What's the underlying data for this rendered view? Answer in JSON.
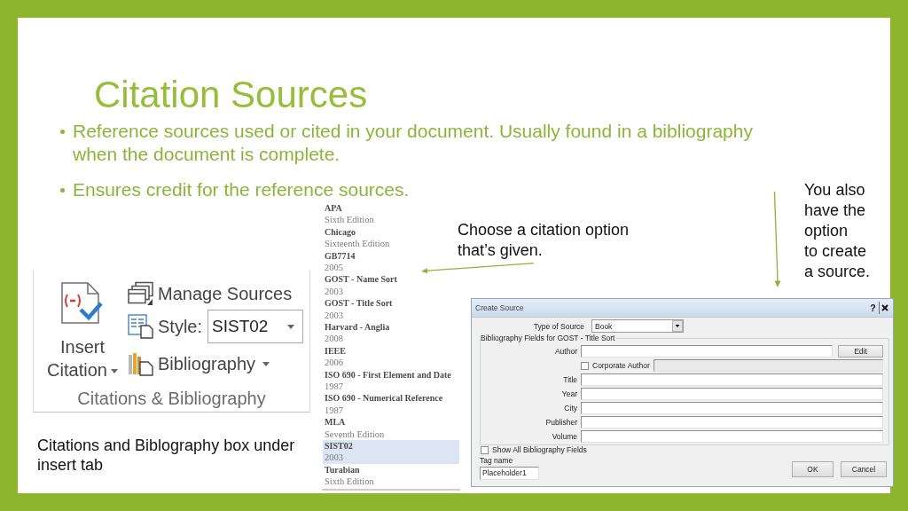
{
  "slide": {
    "title": "Citation Sources",
    "bullets": [
      "Reference sources used or cited in your document. Usually found in a bibliography when the document is complete.",
      "Ensures credit for the reference sources."
    ]
  },
  "style_list": {
    "items": [
      {
        "name": "APA",
        "edition": "Sixth Edition",
        "selected": false
      },
      {
        "name": "Chicago",
        "edition": "Sixteenth Edition",
        "selected": false
      },
      {
        "name": "GB7714",
        "edition": "2005",
        "selected": false
      },
      {
        "name": "GOST - Name Sort",
        "edition": "2003",
        "selected": false
      },
      {
        "name": "GOST - Title Sort",
        "edition": "2003",
        "selected": false
      },
      {
        "name": "Harvard - Anglia",
        "edition": "2008",
        "selected": false
      },
      {
        "name": "IEEE",
        "edition": "2006",
        "selected": false
      },
      {
        "name": "ISO 690 - First Element and Date",
        "edition": "1987",
        "selected": false
      },
      {
        "name": "ISO 690 - Numerical Reference",
        "edition": "1987",
        "selected": false
      },
      {
        "name": "MLA",
        "edition": "Seventh Edition",
        "selected": false
      },
      {
        "name": "SIST02",
        "edition": "2003",
        "selected": true
      },
      {
        "name": "Turabian",
        "edition": "Sixth Edition",
        "selected": false
      }
    ]
  },
  "list_callout": "Choose a citation option that’s given.",
  "dialog_callout": "You also\nhave the\noption\nto create\na source.",
  "ribbon_group": {
    "insert_citation": "Insert Citation",
    "manage_sources": "Manage Sources",
    "style_label": "Style:",
    "style_value": "SIST02",
    "bibliography": "Bibliography",
    "group_label": "Citations & Bibliography"
  },
  "create_source_dialog": {
    "title": "Create Source",
    "help_button": "?",
    "source_type": {
      "label": "Type of Source",
      "value": "Book"
    },
    "group_label": "Bibliography Fields for GOST - Title Sort",
    "fields": [
      {
        "kind": "text_button",
        "label": "Author",
        "button": "Edit"
      },
      {
        "kind": "checkbox",
        "label": "Corporate Author",
        "checked": false,
        "disabled": true
      },
      {
        "kind": "text",
        "label": "Title"
      },
      {
        "kind": "text",
        "label": "Year"
      },
      {
        "kind": "text",
        "label": "City"
      },
      {
        "kind": "text",
        "label": "Publisher"
      },
      {
        "kind": "text",
        "label": "Volume"
      }
    ],
    "show_all": {
      "label": "Show All Bibliography Fields",
      "checked": false
    },
    "tag_name": {
      "label": "Tag name",
      "value": "Placeholder1"
    },
    "ok_button": "OK",
    "cancel_button": "Cancel"
  },
  "ribbon_caption": "Citations and Biblography box under insert tab"
}
